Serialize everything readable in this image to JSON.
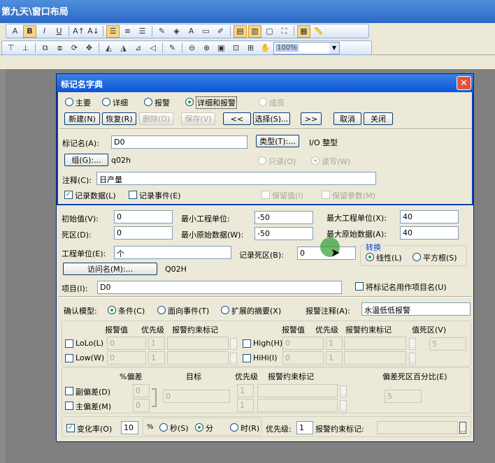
{
  "app": {
    "title": "第九天\\窗口布局",
    "zoom": "100%"
  },
  "dialog": {
    "title": "标记名字典",
    "tabs": [
      "主要",
      "详细",
      "报警",
      "详细和报警",
      "成员"
    ],
    "buttons": {
      "new": "新建(N)",
      "restore": "恢复(R)",
      "delete": "删除(D)",
      "save": "保存(V)",
      "prev": "<<",
      "select": "选择(S)...",
      "next": ">>",
      "cancel": "取消",
      "close": "关闭"
    },
    "tagname_label": "标记名(A):",
    "tagname_value": "D0",
    "type_button": "类型(T):...",
    "type_value": "I/O 整型",
    "group_button": "组(G):...",
    "group_value": "q02h",
    "readonly_label": "只读(O)",
    "readwrite_label": "读写(W)",
    "comment_label": "注释(C):",
    "comment_value": "日产量",
    "log_data": "记录数据(L)",
    "log_events": "记录事件(E)",
    "retain_value": "保留值(I)",
    "retain_params": "保留参数(M)"
  },
  "detail": {
    "init_label": "初始值(V):",
    "init_value": "0",
    "min_eu_label": "最小工程单位:",
    "min_eu_value": "-50",
    "max_eu_label": "最大工程单位(X):",
    "max_eu_value": "40",
    "deadband_label": "死区(D):",
    "deadband_value": "0",
    "min_raw_label": "最小原始数据(W):",
    "min_raw_value": "-50",
    "max_raw_label": "最大原始数据(A):",
    "max_raw_value": "40",
    "eu_label": "工程单位(E):",
    "eu_value": "个",
    "log_deadband_label": "记录死区(B):",
    "log_deadband_value": "0",
    "conversion_title": "转换",
    "linear": "线性(L)",
    "sqrt": "平方根(S)",
    "access_button": "访问名(M):...",
    "access_value": "Q02H",
    "item_label": "项目(I):",
    "item_value": "D0",
    "use_tagname": "将标记名用作项目名(U)"
  },
  "alarm": {
    "model_label": "确认模型:",
    "model_cond": "条件(C)",
    "model_event": "面向事件(T)",
    "model_ext": "扩展的摘要(X)",
    "comment_label": "报警注释(A):",
    "comment_value": "水温低低报警",
    "col_value": "报警值",
    "col_priority": "优先级",
    "col_inhibit": "报警约束标记",
    "col_value_db": "值死区(V)",
    "lolo": "LoLo(L)",
    "low": "Low(W)",
    "high": "High(H)",
    "hihi": "HiHi(I)",
    "v0": "0",
    "p1": "1",
    "value_db": "5",
    "pct_dev": "%偏差",
    "target": "目标",
    "dev_priority": "优先级",
    "dev_inhibit": "报警约束标记",
    "dev_db": "偏差死区百分比(E)",
    "minor_dev": "副偏差(D)",
    "major_dev": "主偏差(M)",
    "dev_db_value": "5",
    "roc_label": "变化率(O)",
    "roc_value": "10",
    "roc_pct": "%",
    "sec": "秒(S)",
    "min": "分",
    "hour": "时(R)",
    "roc_priority_label": "优先级:",
    "roc_priority_value": "1",
    "roc_inhibit_label": "报警约束标记:"
  }
}
